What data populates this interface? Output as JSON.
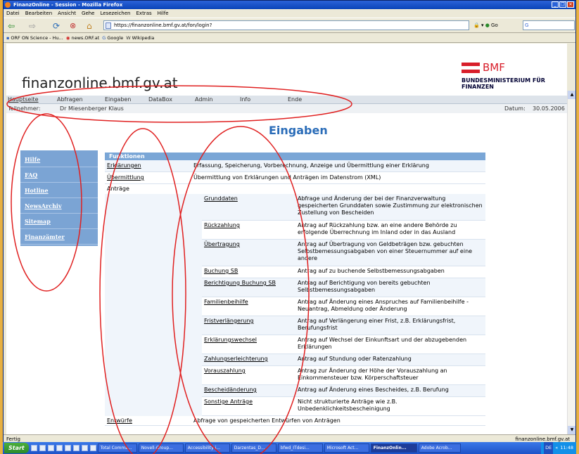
{
  "window": {
    "title": "FinanzOnline - Session - Mozilla Firefox"
  },
  "menu": [
    "Datei",
    "Bearbeiten",
    "Ansicht",
    "Gehe",
    "Lesezeichen",
    "Extras",
    "Hilfe"
  ],
  "toolbar": {
    "url": "https://finanzonline.bmf.gv.at/fon/login?",
    "go": "Go",
    "search": "G"
  },
  "bookmarks": [
    {
      "icon": "▪",
      "label": "ORF ON Science - Hu..."
    },
    {
      "icon": "◉",
      "label": "news.ORF.at"
    },
    {
      "icon": "G",
      "label": "Google"
    },
    {
      "icon": "W",
      "label": "Wikipedia"
    }
  ],
  "site": {
    "name": "finanzonline.bmf.gv.at",
    "logo_short": "BMF",
    "logo_long": "BUNDESMINISTERIUM FÜR FINANZEN"
  },
  "topnav": [
    "Hauptseite",
    "Abfragen",
    "Eingaben",
    "DataBox",
    "Admin",
    "Info",
    "Ende"
  ],
  "userbar": {
    "participant_label": "Teilnehmer:",
    "participant": "Dr Miesenberger Klaus",
    "date_label": "Datum:",
    "date": "30.05.2006"
  },
  "page_title": "Eingaben",
  "leftnav": [
    "Hilfe",
    "FAQ",
    "Hotline",
    "NewsArchiv",
    "Sitemap",
    "Finanzämter"
  ],
  "table": {
    "header": "Funktionen",
    "rows": [
      {
        "name": "Erklärungen",
        "desc": "Erfassung, Speicherung, Vorberechnung, Anzeige und Übermittlung einer Erklärung"
      },
      {
        "name": "Übermittlung",
        "desc": "Übermittlung von Erklärungen und Anträgen im Datenstrom (XML)"
      }
    ],
    "antraege_label": "Anträge",
    "antraege": [
      {
        "name": "Grunddaten",
        "desc": "Abfrage und Änderung der bei der Finanzverwaltung gespeicherten Grunddaten sowie Zustimmung zur elektronischen Zustellung von Bescheiden"
      },
      {
        "name": "Rückzahlung",
        "desc": "Antrag auf Rückzahlung bzw. an eine andere Behörde zu erfolgende Überrechnung im Inland oder in das Ausland"
      },
      {
        "name": "Übertragung",
        "desc": "Antrag auf Übertragung von Geldbeträgen bzw. gebuchten Selbstbemessungsabgaben von einer Steuernummer auf eine andere"
      },
      {
        "name": "Buchung SB",
        "desc": "Antrag auf zu buchende Selbstbemessungsabgaben"
      },
      {
        "name": "Berichtigung Buchung SB",
        "desc": "Antrag auf Berichtigung von bereits gebuchten Selbstbemessungsabgaben"
      },
      {
        "name": "Familienbeihilfe",
        "desc": "Antrag auf Änderung eines Anspruches auf Familienbeihilfe - Neuantrag, Abmeldung oder Änderung"
      },
      {
        "name": "Fristverlängerung",
        "desc": "Antrag auf Verlängerung einer Frist, z.B. Erklärungsfrist, Berufungsfrist"
      },
      {
        "name": "Erklärungswechsel",
        "desc": "Antrag auf Wechsel der Einkunftsart und der abzugebenden Erklärungen"
      },
      {
        "name": "Zahlungserleichterung",
        "desc": "Antrag auf Stundung oder Ratenzahlung"
      },
      {
        "name": "Vorauszahlung",
        "desc": "Antrag zur Änderung der Höhe der Vorauszahlung an Einkommensteuer bzw. Körperschaftsteuer"
      },
      {
        "name": "Bescheidänderung",
        "desc": "Antrag auf Änderung eines Bescheides, z.B. Berufung"
      },
      {
        "name": "Sonstige Anträge",
        "desc": "Nicht strukturierte Anträge wie z.B. Unbedenklichkeitsbescheinigung"
      }
    ],
    "entwuerfe": {
      "name": "Entwürfe",
      "desc": "Abfrage von gespeicherten Entwürfen von Anträgen"
    }
  },
  "status": {
    "left": "Fertig",
    "right": "finanzonline.bmf.gv.at"
  },
  "taskbar": {
    "start": "Start",
    "items": [
      "Total Comma...",
      "Novell-Group...",
      "Accessibility i...",
      "Darzentas_D...",
      "bfwd_ITdesi...",
      "Microsoft Act...",
      "FinanzOnlin...",
      "Adobe Acrob..."
    ],
    "active_index": 6,
    "tray": {
      "lang": "DE",
      "time": "11:48"
    }
  },
  "colors": {
    "accent": "#2a6cb8",
    "nav": "#7ba4d4",
    "annotation": "#e02020"
  }
}
